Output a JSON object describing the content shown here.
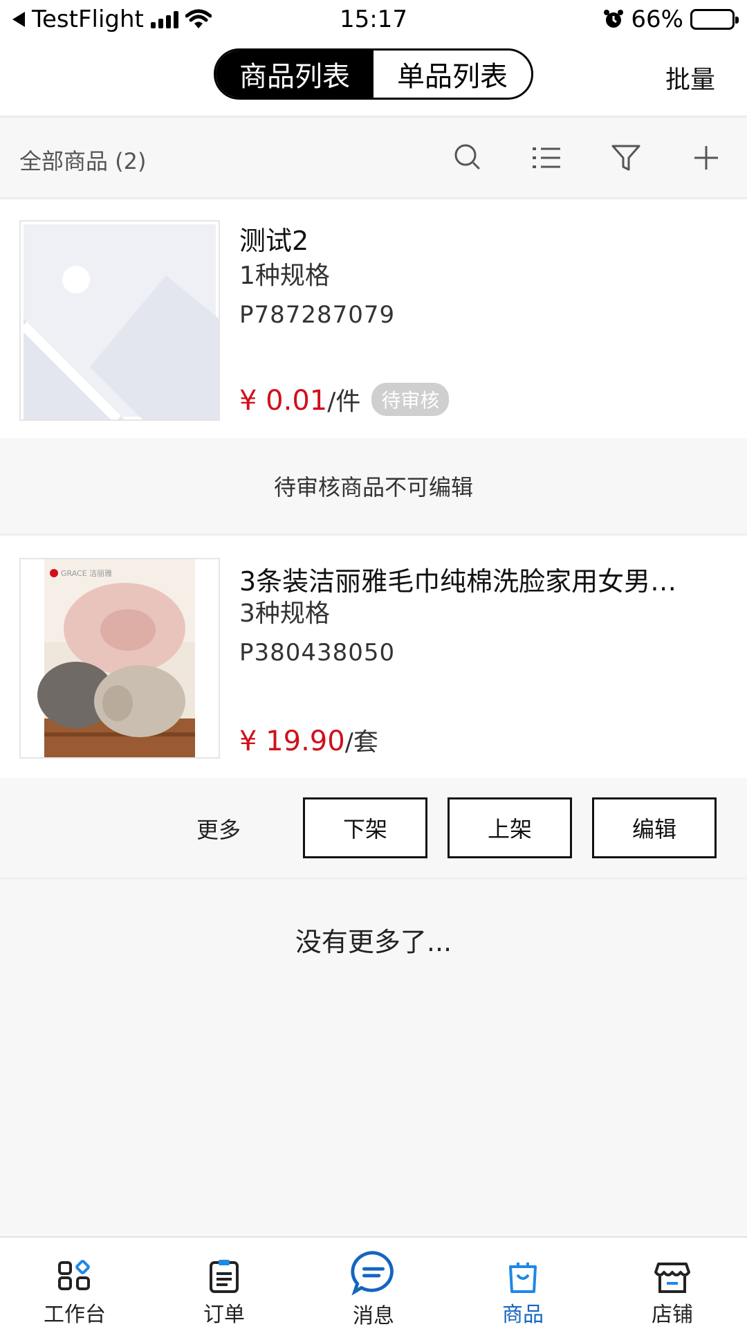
{
  "status_bar": {
    "back_app": "TestFlight",
    "time": "15:17",
    "battery_percent": "66%",
    "battery_level": 0.66
  },
  "top_nav": {
    "tabs": [
      {
        "label": "商品列表",
        "active": true
      },
      {
        "label": "单品列表",
        "active": false
      }
    ],
    "batch_label": "批量"
  },
  "filter": {
    "title": "全部商品 (2)",
    "icons": [
      "search-icon",
      "list-icon",
      "filter-icon",
      "add-icon"
    ]
  },
  "products": [
    {
      "name": "测试2",
      "spec": "1种规格",
      "code": "P787287079",
      "price": "¥ 0.01",
      "unit": "/件",
      "badge": "待审核",
      "note": "待审核商品不可编辑"
    },
    {
      "name": "3条装洁丽雅毛巾纯棉洗脸家用女男…",
      "spec": "3种规格",
      "code": "P380438050",
      "price": "¥ 19.90",
      "unit": "/套",
      "thumb_brand": "GRACE 洁丽雅"
    }
  ],
  "actions": {
    "more": "更多",
    "off_shelf": "下架",
    "on_shelf": "上架",
    "edit": "编辑"
  },
  "end_text": "没有更多了...",
  "tabbar": [
    {
      "label": "工作台",
      "icon": "workbench-icon",
      "active": false
    },
    {
      "label": "订单",
      "icon": "order-icon",
      "active": false
    },
    {
      "label": "消息",
      "icon": "message-icon",
      "active": false
    },
    {
      "label": "商品",
      "icon": "product-bag-icon",
      "active": true
    },
    {
      "label": "店铺",
      "icon": "store-icon",
      "active": false
    }
  ],
  "colors": {
    "price": "#d0101b",
    "accent": "#1565c0",
    "badge": "#cfcfcf"
  }
}
